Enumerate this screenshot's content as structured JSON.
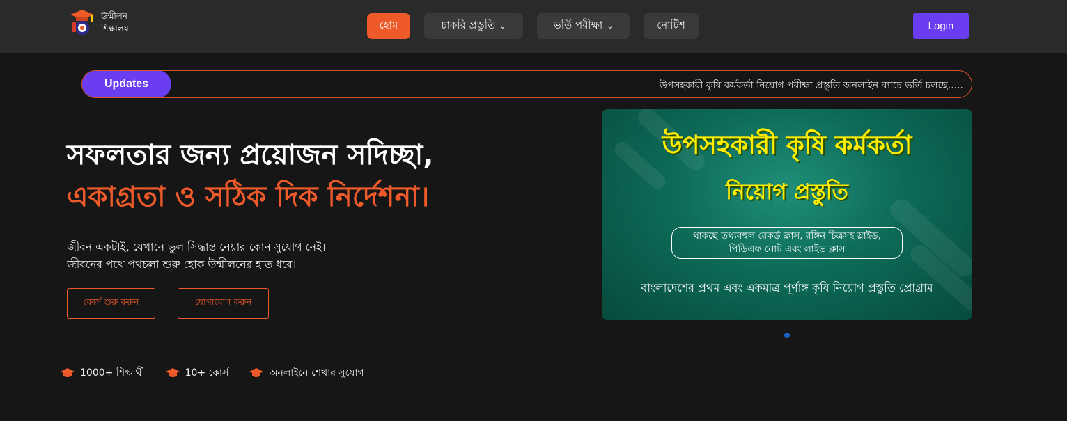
{
  "brand": {
    "name_line1": "উন্মীলন",
    "name_line2": "শিক্ষালয়"
  },
  "nav": {
    "items": [
      {
        "label": "হোম",
        "active": true,
        "dropdown": false
      },
      {
        "label": "চাকরি প্রস্তুতি",
        "active": false,
        "dropdown": true
      },
      {
        "label": "ভর্তি পরীক্ষা",
        "active": false,
        "dropdown": true
      },
      {
        "label": "নোটিশ",
        "active": false,
        "dropdown": false
      }
    ],
    "login_label": "Login"
  },
  "ticker": {
    "badge": "Updates",
    "text": "উপসহকারী কৃষি কর্মকর্তা নিয়োগ পরীক্ষা প্রস্তুতি অনলাইন ব্যাচে ভর্তি চলছে....."
  },
  "hero": {
    "title_line1": "সফলতার জন্য প্রয়োজন সদিচ্ছা,",
    "title_line2": "একাগ্রতা ও সঠিক দিক নির্দেশনা।",
    "desc_line1": "জীবন একটাই, যেখানে ভুল সিদ্ধান্ত নেয়ার কোন সুযোগ নেই।",
    "desc_line2": "জীবনের পথে পথচলা শুরু হোক উন্মীলনের হাত ধরে।",
    "primary_button": "কোর্স শুরু করুন",
    "secondary_button": "যোগাযোগ করুন"
  },
  "stats": [
    {
      "label": "1000+ শিক্ষার্থী",
      "icon": "graduation-cap-icon"
    },
    {
      "label": "10+ কোর্স",
      "icon": "graduation-cap-icon"
    },
    {
      "label": "অনলাইনে শেখার সুযোগ",
      "icon": "graduation-cap-icon"
    }
  ],
  "banner": {
    "title": "উপসহকারী কৃষি কর্মকর্তা",
    "subtitle": "নিয়োগ প্রস্তুতি",
    "box_line1": "থাকছে তথ্যবহুল রেকর্ড ক্লাস, রঙ্গিন চিত্রসহ স্লাইড,",
    "box_line2": "পিডিএফ নোট এবং লাইভ ক্লাস",
    "footer": "বাংলাদেশের প্রথম এবং একমাত্র পূর্ণাঙ্গ কৃষি নিয়োগ প্রস্তুতি প্রোগ্রাম"
  },
  "colors": {
    "accent": "#ef5a2a",
    "primary": "#6a3df0",
    "header_bg": "#2a2a2a",
    "page_bg": "#161616",
    "banner_green": "#0d6a57",
    "banner_yellow": "#ffee00"
  }
}
